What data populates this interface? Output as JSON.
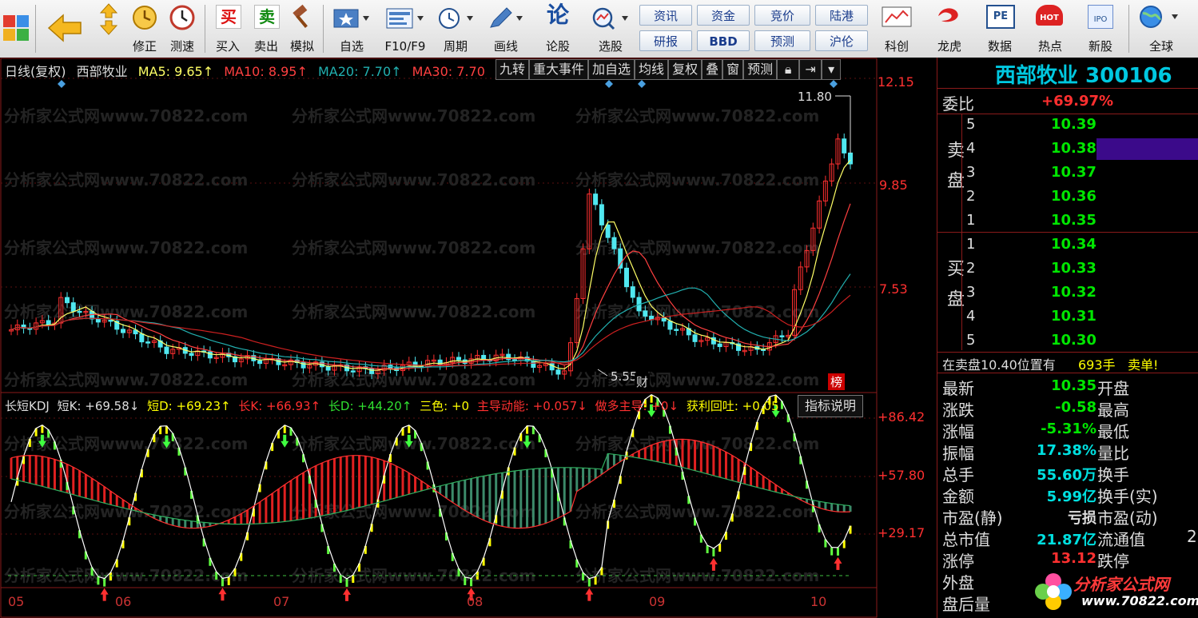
{
  "toolbar": {
    "buttons": [
      {
        "label": "",
        "icon": "grid-icon"
      },
      {
        "label": "",
        "icon": "back-arrow-icon"
      },
      {
        "label": "修正",
        "icon": "up-down-arrows-icon"
      },
      {
        "label": "测速",
        "icon": "clock-icon"
      },
      {
        "label": "买入",
        "icon": "buy-icon",
        "glyph": "买"
      },
      {
        "label": "卖出",
        "icon": "sell-icon",
        "glyph": "卖"
      },
      {
        "label": "模拟",
        "icon": "gavel-icon"
      },
      {
        "label": "自选",
        "icon": "star-folder-icon"
      },
      {
        "label": "F10/F9",
        "icon": "f10-icon"
      },
      {
        "label": "周期",
        "icon": "period-icon"
      },
      {
        "label": "画线",
        "icon": "pen-icon"
      },
      {
        "label": "论股",
        "icon": "discuss-icon",
        "glyph": "论"
      },
      {
        "label": "选股",
        "icon": "select-stock-icon"
      },
      {
        "label": "科创",
        "icon": "kechuang-icon"
      },
      {
        "label": "龙虎",
        "icon": "dragon-tiger-icon"
      },
      {
        "label": "数据",
        "icon": "pe-data-icon",
        "glyph": "PE"
      },
      {
        "label": "热点",
        "icon": "hot-icon",
        "glyph": "HOT"
      },
      {
        "label": "新股",
        "icon": "ipo-icon",
        "glyph": "IPO"
      },
      {
        "label": "全球",
        "icon": "globe-icon"
      }
    ],
    "small_buttons": [
      "资讯",
      "资金",
      "竞价",
      "陆港",
      "研报",
      "BBD",
      "预测",
      "沪伦"
    ]
  },
  "chart": {
    "header": [
      {
        "text": "日线(复权)",
        "color": "#dddddd"
      },
      {
        "text": "西部牧业",
        "color": "#dddddd"
      },
      {
        "text": "MA5: 9.65↑",
        "color": "#ffff66"
      },
      {
        "text": "MA10: 8.95↑",
        "color": "#ff4040"
      },
      {
        "text": "MA20: 7.70↑",
        "color": "#22b0b0"
      },
      {
        "text": "MA30: 7.70",
        "color": "#ff4040"
      }
    ],
    "tools": [
      "九转",
      "重大事件",
      "加自选",
      "均线",
      "复权",
      "叠",
      "窗",
      "预测"
    ],
    "price_axis": [
      "12.15",
      "9.85",
      "7.53"
    ],
    "max_label": "11.80",
    "min_label": "5.55",
    "marker_cai": "财",
    "marker_bang": "榜",
    "watermark": "分析家公式网www.70822.com",
    "indicator": [
      {
        "text": "长短KDJ",
        "color": "#dddddd"
      },
      {
        "text": "短K: +69.58↓",
        "color": "#dddddd"
      },
      {
        "text": "短D: +69.23↑",
        "color": "#ffff00"
      },
      {
        "text": "长K: +66.93↑",
        "color": "#ff3030"
      },
      {
        "text": "长D: +44.20↑",
        "color": "#30e030"
      },
      {
        "text": "三色: +0",
        "color": "#ffff00"
      },
      {
        "text": "主导动能: +0.057↓",
        "color": "#ff3030"
      },
      {
        "text": "做多主导: +0↓",
        "color": "#ff3030"
      },
      {
        "text": "获利回吐: +0.05",
        "color": "#ffff00"
      }
    ],
    "indicator_button": "指标说明",
    "indicator_axis": [
      "+86.42",
      "+57.80",
      "+29.17"
    ],
    "months": [
      "05",
      "06",
      "07",
      "08",
      "09",
      "10"
    ]
  },
  "quote": {
    "title": "西部牧业 300106",
    "webi_label": "委比",
    "webi_value": "+69.97%",
    "sell_label": "卖盘",
    "buy_label": "买盘",
    "sell": [
      {
        "n": "5",
        "price": "10.39"
      },
      {
        "n": "4",
        "price": "10.38"
      },
      {
        "n": "3",
        "price": "10.37"
      },
      {
        "n": "2",
        "price": "10.36"
      },
      {
        "n": "1",
        "price": "10.35"
      }
    ],
    "buy": [
      {
        "n": "1",
        "price": "10.34"
      },
      {
        "n": "2",
        "price": "10.33"
      },
      {
        "n": "3",
        "price": "10.32"
      },
      {
        "n": "4",
        "price": "10.31"
      },
      {
        "n": "5",
        "price": "10.30"
      }
    ],
    "notice_text": "在卖盘10.40位置有",
    "notice_qty": "693手",
    "notice_tail": "卖单!",
    "stats": [
      {
        "label": "最新",
        "value": "10.35",
        "label2": "开盘",
        "color": "#00e600"
      },
      {
        "label": "涨跌",
        "value": "-0.58",
        "label2": "最高",
        "color": "#00e600"
      },
      {
        "label": "涨幅",
        "value": "-5.31%",
        "label2": "最低",
        "color": "#00e600"
      },
      {
        "label": "振幅",
        "value": "17.38%",
        "label2": "量比",
        "color": "#00e0e0"
      },
      {
        "label": "总手",
        "value": "55.60万",
        "label2": "换手",
        "color": "#00e0e0"
      },
      {
        "label": "金额",
        "value": "5.99亿",
        "label2": "换手(实)",
        "color": "#00e0e0"
      },
      {
        "label": "市盈(静)",
        "value": "亏损",
        "label2": "市盈(动)",
        "color": "#dddddd"
      },
      {
        "label": "总市值",
        "value": "21.87亿",
        "label2": "流通值",
        "color": "#00e0e0"
      },
      {
        "label": "涨停",
        "value": "13.12",
        "label2": "跌停",
        "color": "#ff3030"
      },
      {
        "label": "外盘",
        "value": "",
        "label2": "",
        "color": "#dddddd"
      },
      {
        "label": "盘后量",
        "value": "",
        "label2": "",
        "color": "#dddddd"
      }
    ],
    "extra_right": "2",
    "logo_text": "分析家公式网",
    "logo_url": "www.70822.com"
  }
}
